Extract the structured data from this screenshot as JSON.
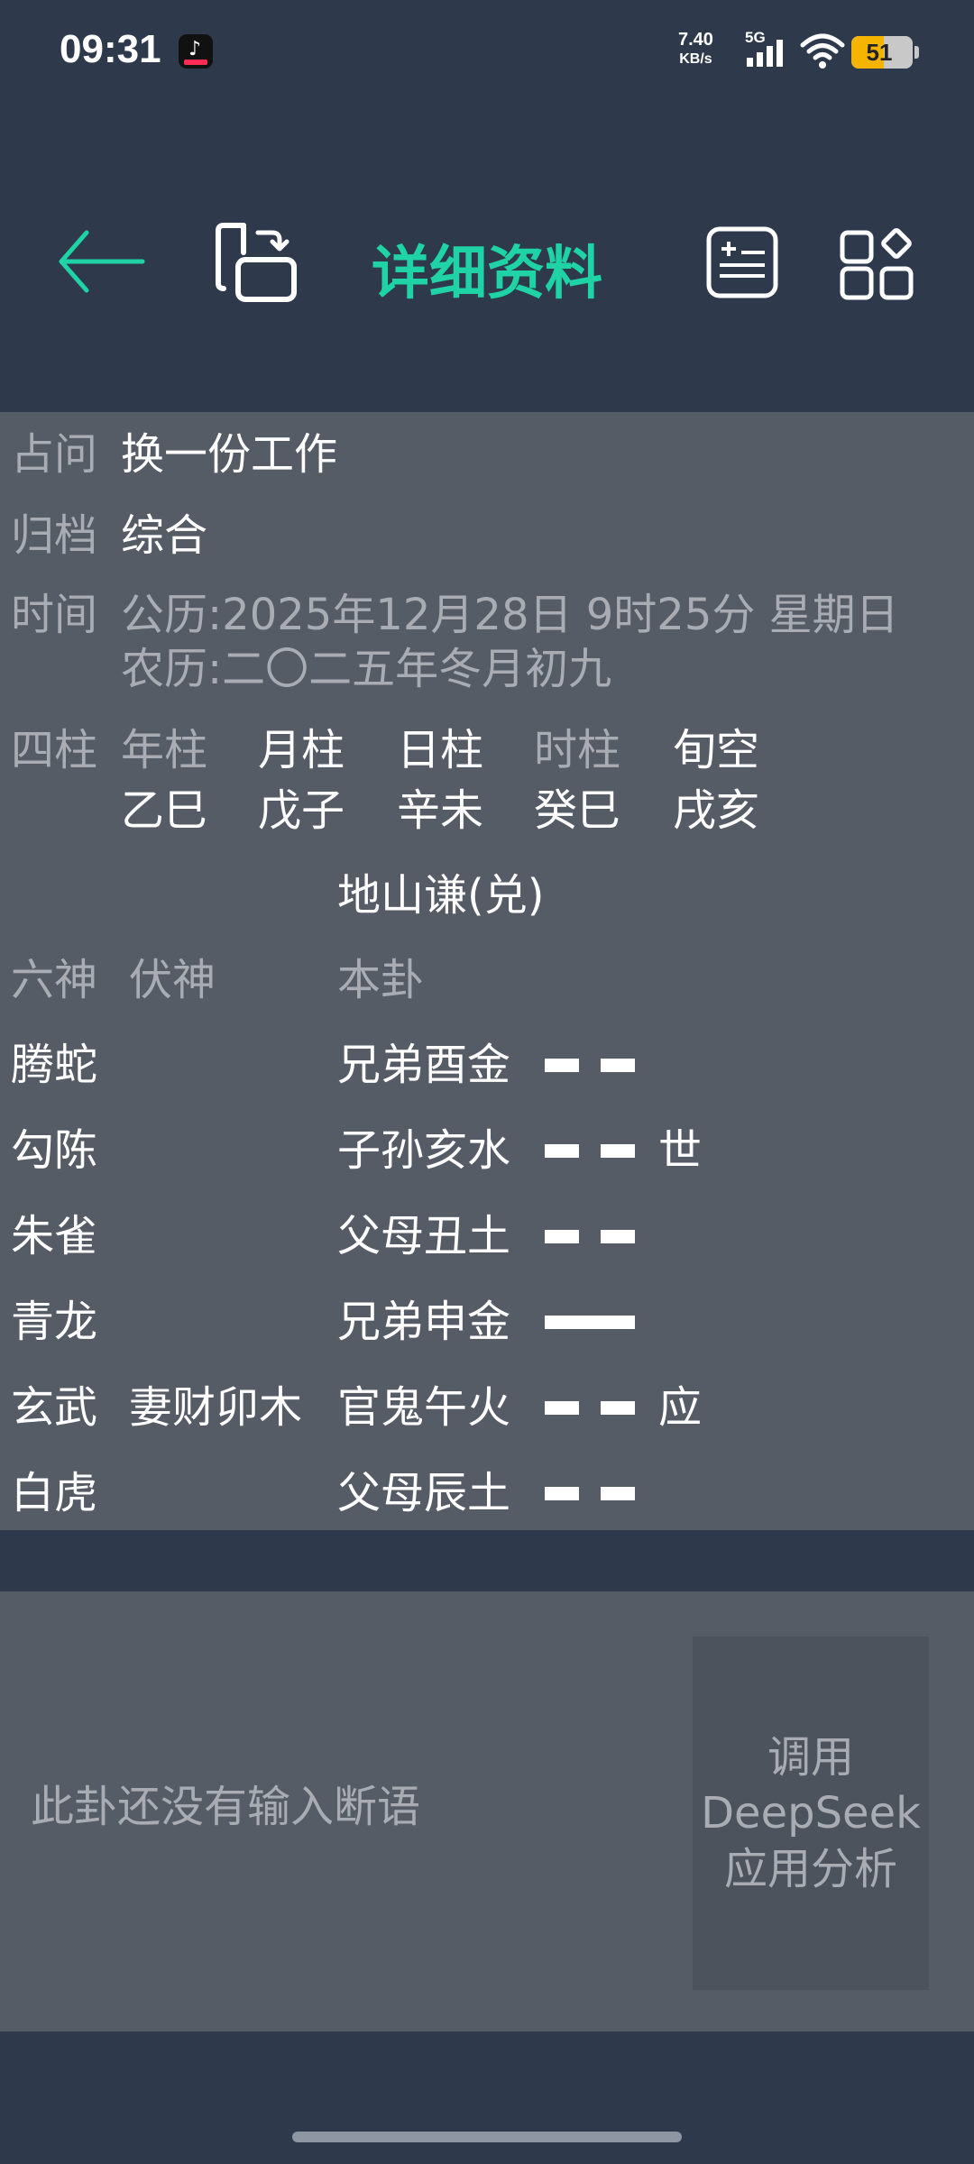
{
  "status": {
    "time": "09:31",
    "speed_value": "7.40",
    "speed_unit": "KB/s",
    "network": "5G",
    "battery": "51",
    "battery_color": "#f5b400"
  },
  "toolbar": {
    "title": "详细资料",
    "title_color": "#1fd3a6",
    "icons": [
      "back-arrow-icon",
      "rotate-screen-icon",
      "add-note-icon",
      "widgets-icon"
    ]
  },
  "info": {
    "question_label": "占问",
    "question": "换一份工作",
    "category_label": "归档",
    "category": "综合",
    "time_label": "时间",
    "solar": "公历:2025年12月28日  9时25分 星期日",
    "lunar": "农历:二〇二五年冬月初九",
    "pillars_label": "四柱",
    "pillars": [
      {
        "name": "年柱",
        "value": "乙巳"
      },
      {
        "name": "月柱",
        "value": "戊子"
      },
      {
        "name": "日柱",
        "value": "辛未"
      },
      {
        "name": "时柱",
        "value": "癸巳"
      },
      {
        "name": "旬空",
        "value": "戌亥"
      }
    ]
  },
  "hexagram": {
    "name": "地山谦(兑)",
    "headers": {
      "liushen": "六神",
      "fushen": "伏神",
      "bengua": "本卦"
    },
    "lines": [
      {
        "liushen": "腾蛇",
        "fushen": "",
        "relation": "兄弟酉金",
        "yin": true,
        "mark": ""
      },
      {
        "liushen": "勾陈",
        "fushen": "",
        "relation": "子孙亥水",
        "yin": true,
        "mark": "世"
      },
      {
        "liushen": "朱雀",
        "fushen": "",
        "relation": "父母丑土",
        "yin": true,
        "mark": ""
      },
      {
        "liushen": "青龙",
        "fushen": "",
        "relation": "兄弟申金",
        "yin": false,
        "mark": ""
      },
      {
        "liushen": "玄武",
        "fushen": "妻财卯木",
        "relation": "官鬼午火",
        "yin": true,
        "mark": "应"
      },
      {
        "liushen": "白虎",
        "fushen": "",
        "relation": "父母辰土",
        "yin": true,
        "mark": ""
      }
    ]
  },
  "analysis": {
    "placeholder": "此卦还没有输入断语",
    "button": "调用\nDeepSeek\n应用分析"
  }
}
